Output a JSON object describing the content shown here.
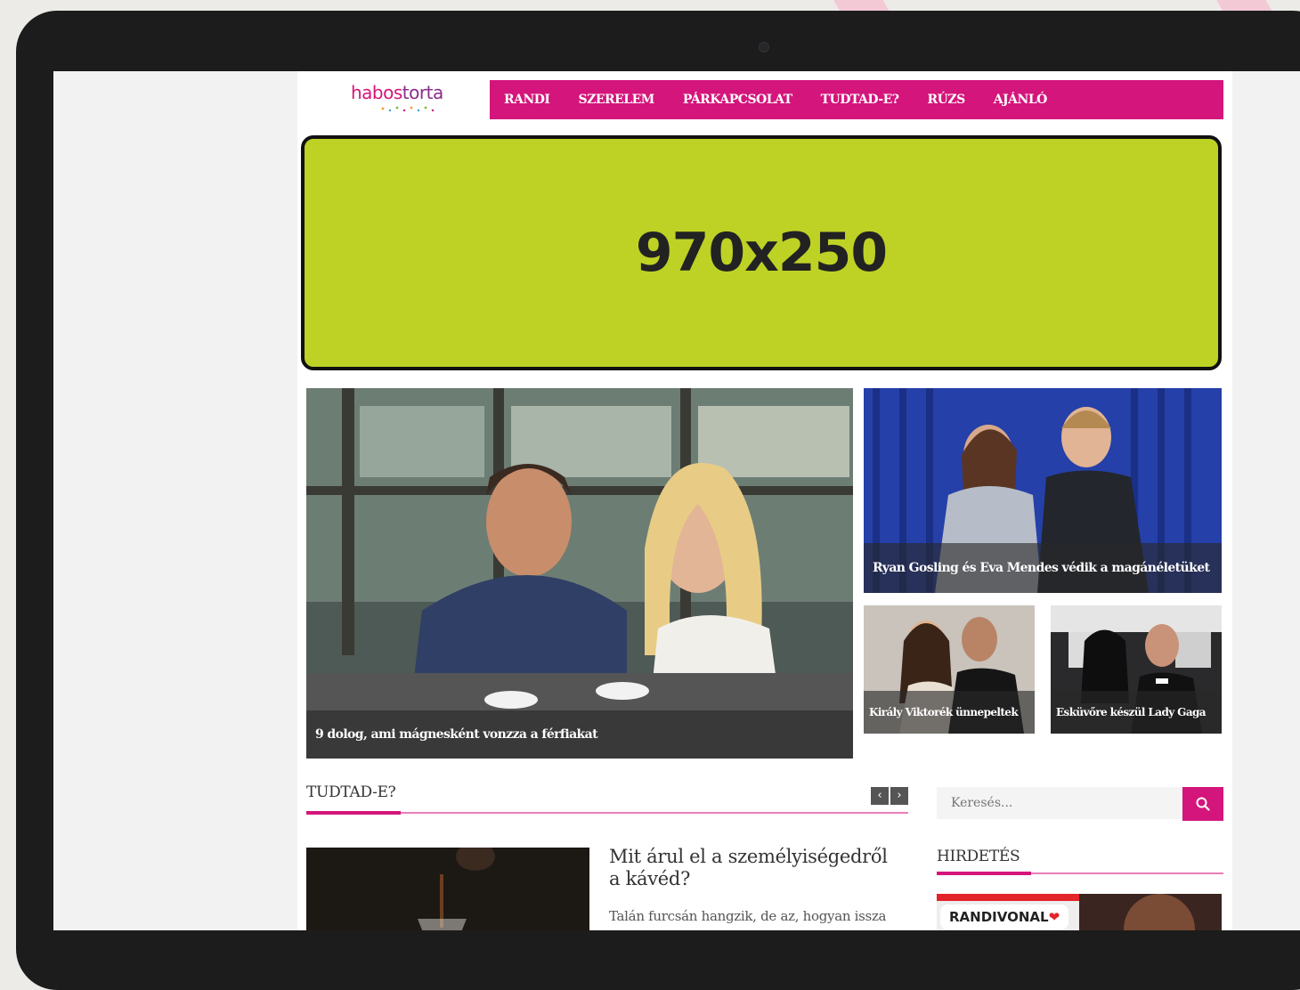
{
  "site": {
    "logo_part1": "habos",
    "logo_part2": "torta"
  },
  "nav": {
    "items": [
      "RANDI",
      "SZERELEM",
      "PÁRKAPCSOLAT",
      "TUDTAD-E?",
      "RÚZS",
      "AJÁNLÓ"
    ]
  },
  "ad": {
    "size_label": "970x250"
  },
  "featured": {
    "main": {
      "caption": "9 dolog, ami mágnesként vonzza a férfiakat"
    },
    "top_right": {
      "caption": "Ryan Gosling és Eva Mendes védik a magánéletüket"
    },
    "bottom_left": {
      "caption": "Király Viktorék ünnepeltek"
    },
    "bottom_right": {
      "caption": "Esküvőre készül Lady Gaga"
    }
  },
  "section": {
    "title": "TUDTAD-E?",
    "prev_icon": "chevron-left-icon",
    "next_icon": "chevron-right-icon",
    "article": {
      "title": "Mit árul el a személyiségedről a kávéd?",
      "excerpt": "Talán furcsán hangzik, de az, hogyan issza"
    }
  },
  "sidebar": {
    "search_placeholder": "Keresés...",
    "search_icon": "search-icon",
    "ad_title": "HIRDETÉS",
    "banner_logo": "RANDIVONAL"
  },
  "colors": {
    "brand_pink": "#d4157b",
    "ad_green": "#bed225"
  }
}
